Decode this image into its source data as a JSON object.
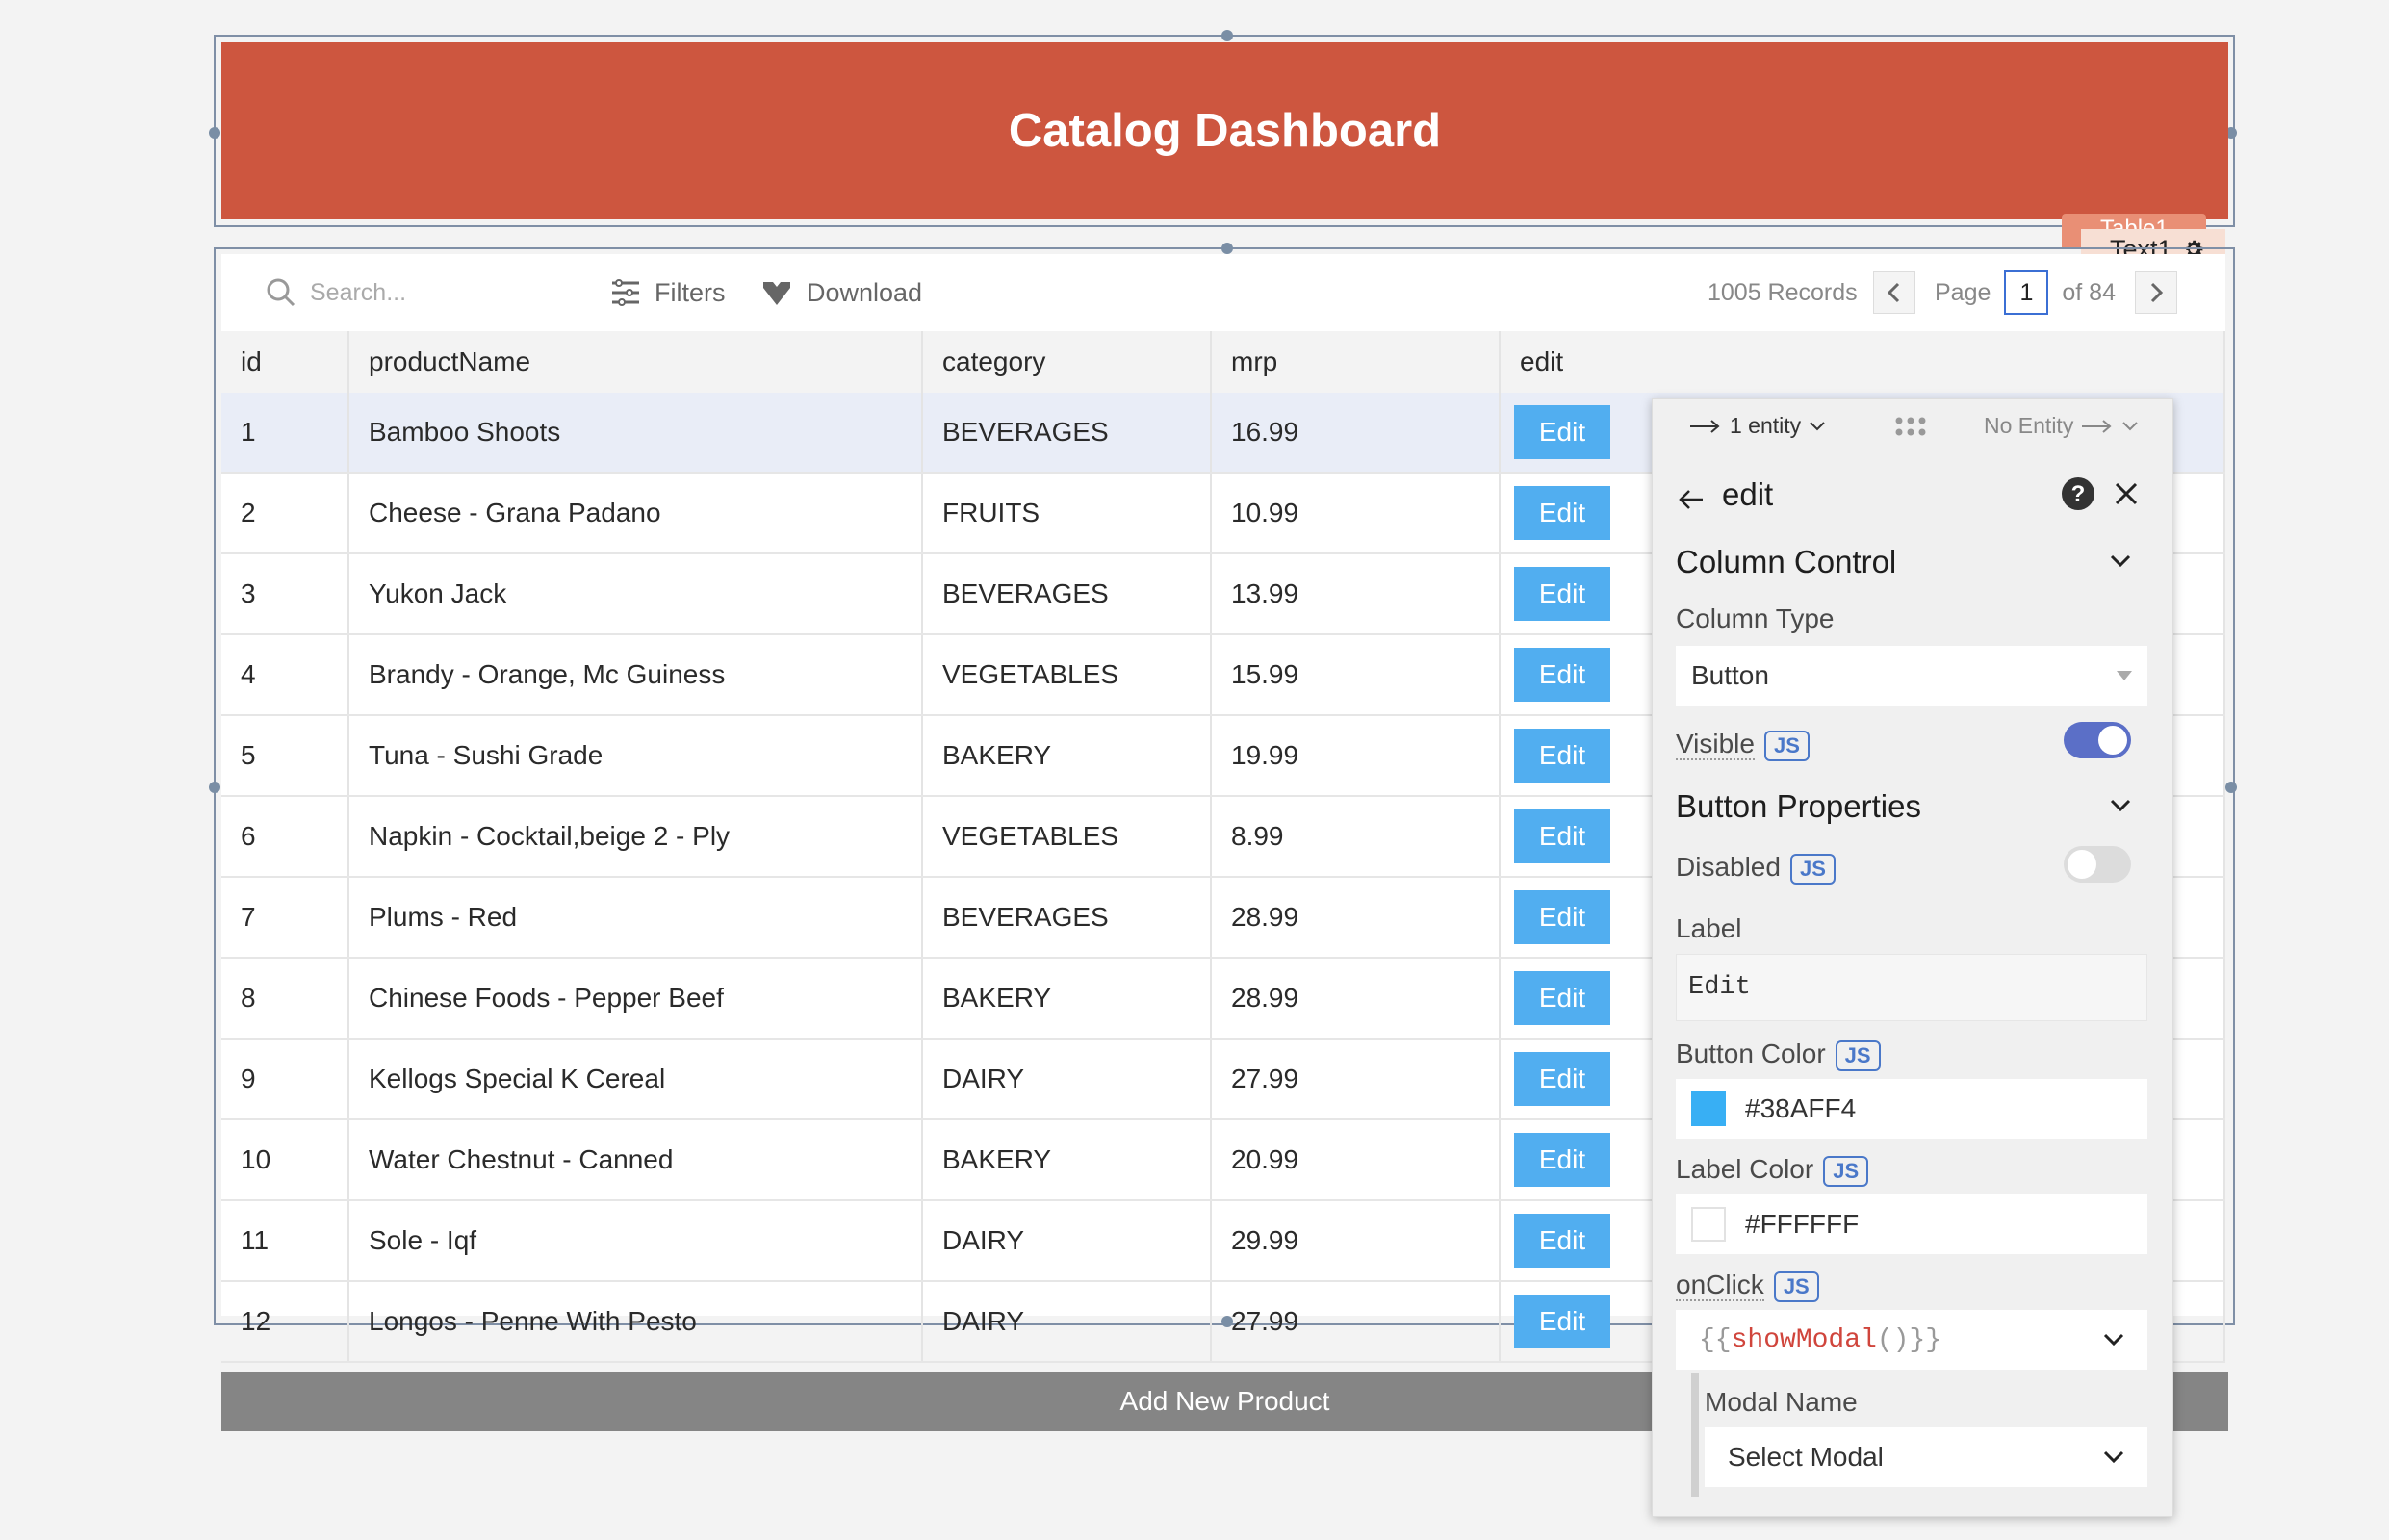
{
  "header": {
    "title": "Catalog Dashboard"
  },
  "widget_tags": {
    "behind": "Table1",
    "front": "Text1"
  },
  "toolbar": {
    "search_placeholder": "Search...",
    "filters_label": "Filters",
    "download_label": "Download",
    "records_label": "1005 Records",
    "page_label": "Page",
    "page_value": "1",
    "page_of": "of 84"
  },
  "table": {
    "columns": [
      "id",
      "productName",
      "category",
      "mrp",
      "edit"
    ],
    "edit_label": "Edit",
    "rows": [
      {
        "id": "1",
        "productName": "Bamboo Shoots",
        "category": "BEVERAGES",
        "mrp": "16.99"
      },
      {
        "id": "2",
        "productName": "Cheese - Grana Padano",
        "category": "FRUITS",
        "mrp": "10.99"
      },
      {
        "id": "3",
        "productName": "Yukon Jack",
        "category": "BEVERAGES",
        "mrp": "13.99"
      },
      {
        "id": "4",
        "productName": "Brandy - Orange, Mc Guiness",
        "category": "VEGETABLES",
        "mrp": "15.99"
      },
      {
        "id": "5",
        "productName": "Tuna - Sushi Grade",
        "category": "BAKERY",
        "mrp": "19.99"
      },
      {
        "id": "6",
        "productName": "Napkin - Cocktail,beige 2 - Ply",
        "category": "VEGETABLES",
        "mrp": "8.99"
      },
      {
        "id": "7",
        "productName": "Plums - Red",
        "category": "BEVERAGES",
        "mrp": "28.99"
      },
      {
        "id": "8",
        "productName": "Chinese Foods - Pepper Beef",
        "category": "BAKERY",
        "mrp": "28.99"
      },
      {
        "id": "9",
        "productName": "Kellogs Special K Cereal",
        "category": "DAIRY",
        "mrp": "27.99"
      },
      {
        "id": "10",
        "productName": "Water Chestnut - Canned",
        "category": "BAKERY",
        "mrp": "20.99"
      },
      {
        "id": "11",
        "productName": "Sole - Iqf",
        "category": "DAIRY",
        "mrp": "29.99"
      },
      {
        "id": "12",
        "productName": "Longos - Penne With Pesto",
        "category": "DAIRY",
        "mrp": "27.99"
      }
    ]
  },
  "add_button": {
    "label": "Add New Product"
  },
  "pane": {
    "entity_in": "1 entity",
    "entity_out": "No Entity",
    "title": "edit",
    "column_control": "Column Control",
    "column_type_label": "Column Type",
    "column_type_value": "Button",
    "visible_label": "Visible",
    "js": "JS",
    "button_properties": "Button Properties",
    "disabled_label": "Disabled",
    "label_label": "Label",
    "label_value": "Edit",
    "button_color_label": "Button Color",
    "button_color_value": "#38AFF4",
    "label_color_label": "Label Color",
    "label_color_value": "#FFFFFF",
    "onclick_label": "onClick",
    "onclick_open": "{{",
    "onclick_fn": "showModal",
    "onclick_parens": "()",
    "onclick_close": "}}",
    "modal_name_label": "Modal Name",
    "modal_select_value": "Select Modal",
    "visible_on": true,
    "disabled_on": false
  },
  "colors": {
    "banner": "#cd563f",
    "edit_button": "#51aef0",
    "toggle_on": "#5b6fc7",
    "add_button": "#858585"
  }
}
